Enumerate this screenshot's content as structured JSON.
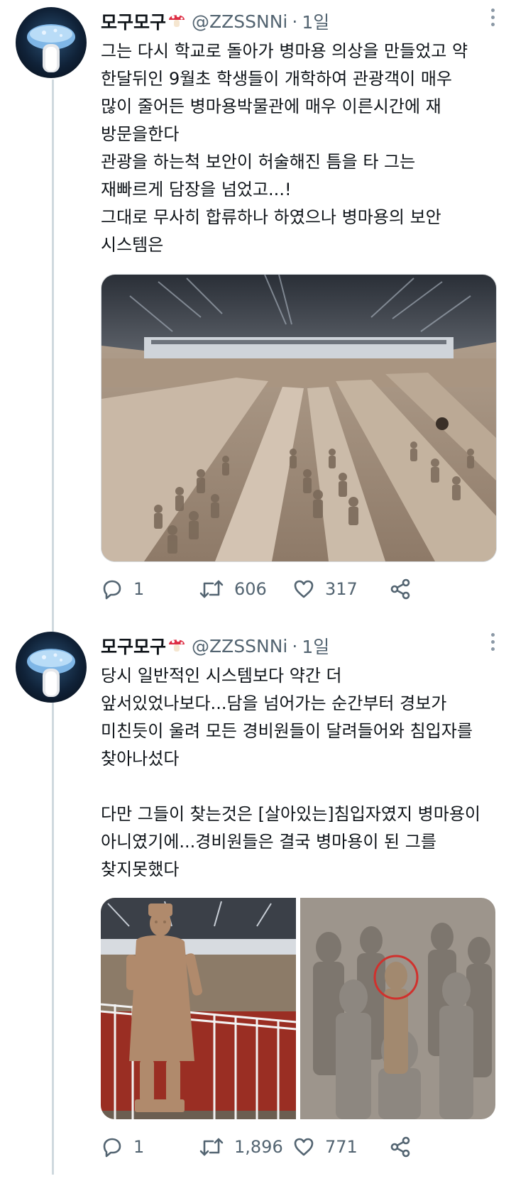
{
  "tweets": [
    {
      "author_name": "모구모구",
      "handle": "@ZZSSNNi",
      "separator": "·",
      "time": "1일",
      "lines": [
        "그는 다시 학교로 돌아가 병마용 의상을 만들었고 약",
        "한달뒤인 9월초 학생들이 개학하여 관광객이 매우",
        "많이 줄어든 병마용박물관에 매우 이른시간에 재",
        "방문을한다",
        "관광을 하는척 보안이 허술해진 틈을 타 그는",
        "재빠르게 담장을 넘었고...!",
        "그대로 무사히 합류하나 하였으나 병마용의 보안",
        "시스템은"
      ],
      "replies": "1",
      "retweets": "606",
      "likes": "317"
    },
    {
      "author_name": "모구모구",
      "handle": "@ZZSSNNi",
      "separator": "·",
      "time": "1일",
      "lines": [
        "당시 일반적인 시스템보다 약간 더",
        "앞서있었나보다...담을 넘어가는 순간부터 경보가",
        "미친듯이 울려 모든 경비원들이 달려들어와 침입자를",
        "찾아나섰다",
        "",
        "다만 그들이 찾는것은 [살아있는]침입자였지 병마용이",
        "아니였기에...경비원들은 결국 병마용이 된 그를",
        "찾지못했다"
      ],
      "replies": "1",
      "retweets": "1,896",
      "likes": "771"
    }
  ],
  "colors": {
    "text": "#0f1419",
    "muted": "#536471",
    "thread_line": "#cfd9de",
    "circle_highlight": "#d0312d"
  },
  "icons": [
    "mushroom-emoji",
    "more-dots-icon",
    "reply-icon",
    "retweet-icon",
    "like-icon",
    "share-icon"
  ]
}
